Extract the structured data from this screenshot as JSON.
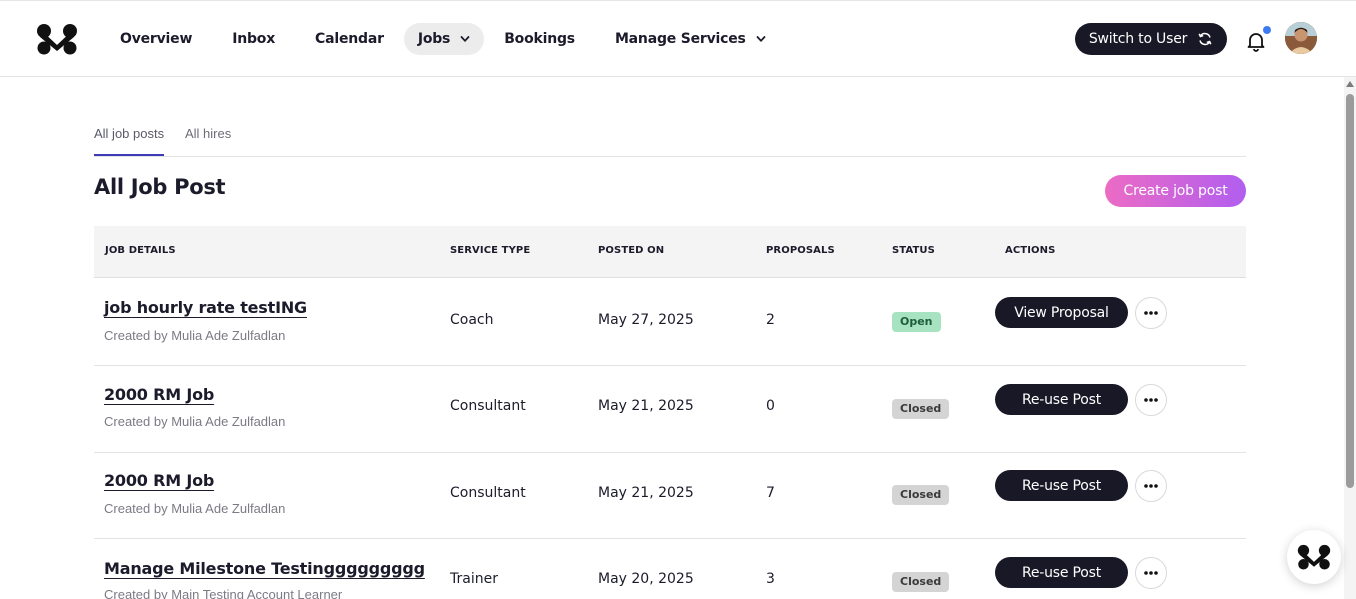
{
  "nav": {
    "items": [
      {
        "label": "Overview"
      },
      {
        "label": "Inbox"
      },
      {
        "label": "Calendar"
      },
      {
        "label": "Jobs",
        "active": true,
        "dropdown": true
      },
      {
        "label": "Bookings"
      },
      {
        "label": "Manage Services",
        "dropdown": true
      }
    ],
    "switch_label": "Switch to User",
    "notification_dot_color": "#3d7bf5"
  },
  "tabs": [
    {
      "label": "All job posts",
      "active": true
    },
    {
      "label": "All hires"
    }
  ],
  "page": {
    "title": "All Job Post",
    "create_label": "Create job post"
  },
  "table": {
    "headers": {
      "job_details": "JOB DETAILS",
      "service_type": "SERVICE TYPE",
      "posted_on": "POSTED ON",
      "proposals": "PROPOSALS",
      "status": "STATUS",
      "actions": "ACTIONS"
    },
    "rows": [
      {
        "title": "job hourly rate testING",
        "creator": "Created by Mulia Ade Zulfadlan",
        "service": "Coach",
        "posted": "May 27, 2025",
        "proposals": "2",
        "status": "Open",
        "action": "View Proposal"
      },
      {
        "title": "2000 RM Job",
        "creator": "Created by Mulia Ade Zulfadlan",
        "service": "Consultant",
        "posted": "May 21, 2025",
        "proposals": "0",
        "status": "Closed",
        "action": "Re-use Post"
      },
      {
        "title": "2000 RM Job",
        "creator": "Created by Mulia Ade Zulfadlan",
        "service": "Consultant",
        "posted": "May 21, 2025",
        "proposals": "7",
        "status": "Closed",
        "action": "Re-use Post"
      },
      {
        "title": "Manage Milestone Testinggggggggg",
        "creator": "Created by Main Testing Account Learner",
        "service": "Trainer",
        "posted": "May 20, 2025",
        "proposals": "3",
        "status": "Closed",
        "action": "Re-use Post"
      }
    ]
  },
  "colors": {
    "primary_dark": "#181826",
    "create_gradient_start": "#ec6bc4",
    "create_gradient_end": "#b15ef0",
    "open_badge": "#a7e3c0",
    "closed_badge": "#d4d4d4",
    "tab_underline": "#3c3cb8"
  }
}
